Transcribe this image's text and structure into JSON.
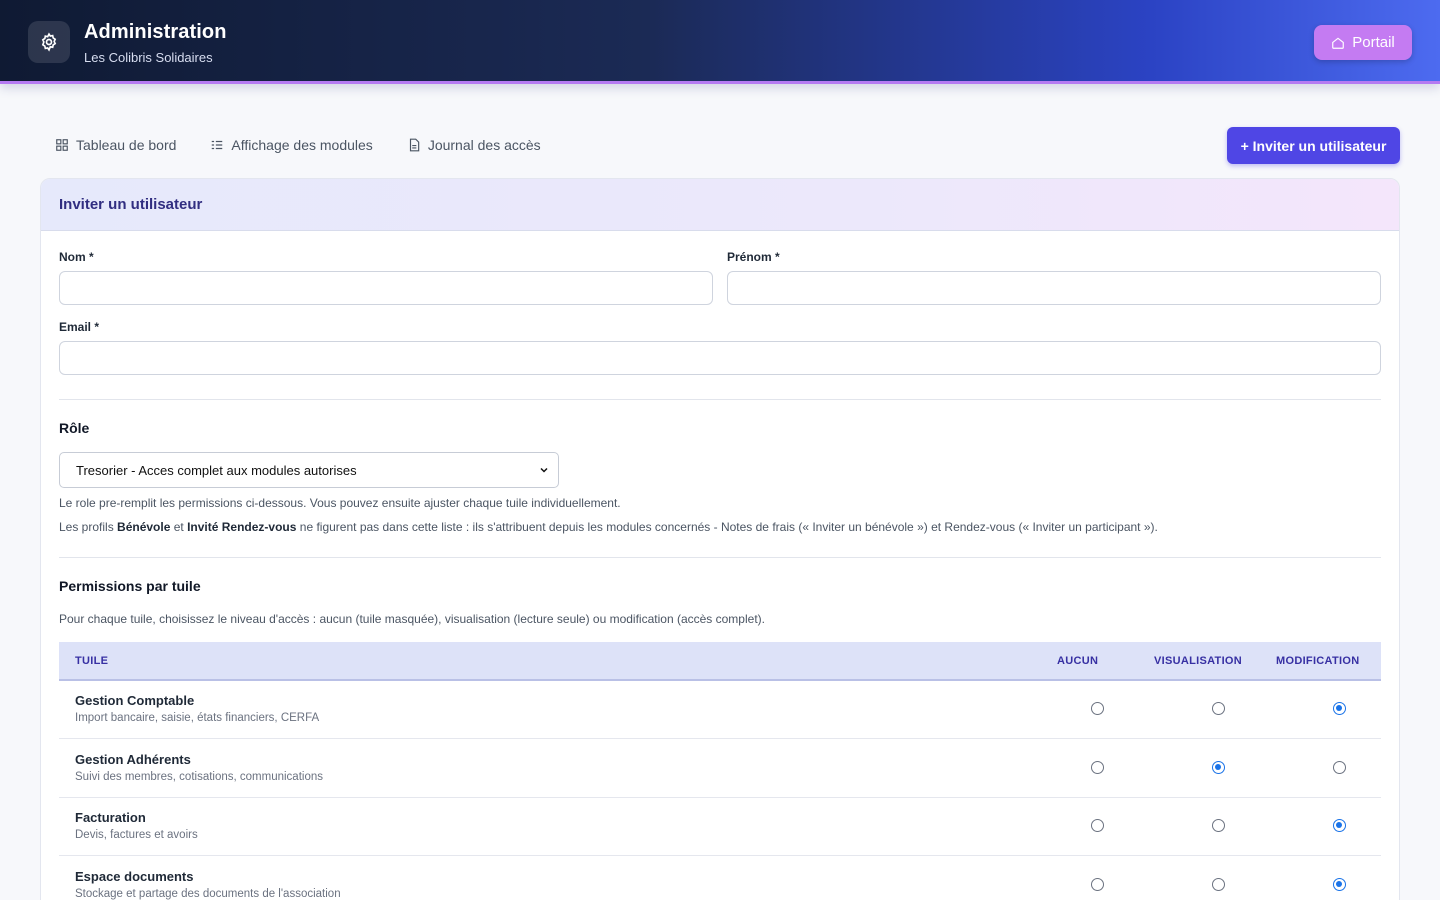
{
  "header": {
    "title": "Administration",
    "subtitle": "Les Colibris Solidaires",
    "portal_label": "Portail"
  },
  "nav": {
    "items": [
      {
        "label": "Tableau de bord",
        "icon": "dashboard-grid-icon"
      },
      {
        "label": "Affichage des modules",
        "icon": "list-icon"
      },
      {
        "label": "Journal des accès",
        "icon": "document-icon"
      }
    ],
    "invite_label": "+ Inviter un utilisateur"
  },
  "form": {
    "card_title": "Inviter un utilisateur",
    "nom_label": "Nom *",
    "prenom_label": "Prénom *",
    "email_label": "Email *",
    "role_title": "Rôle",
    "role_selected": "Tresorier - Acces complet aux modules autorises",
    "role_hint": "Le role pre-remplit les permissions ci-dessous. Vous pouvez ensuite ajuster chaque tuile individuellement.",
    "profiles_hint_prefix": "Les profils ",
    "profiles_hint_b1": "Bénévole",
    "profiles_hint_mid": " et ",
    "profiles_hint_b2": "Invité Rendez-vous",
    "profiles_hint_suffix": " ne figurent pas dans cette liste : ils s'attribuent depuis les modules concernés - Notes de frais (« Inviter un bénévole ») et Rendez-vous (« Inviter un participant »).",
    "perm_title": "Permissions par tuile",
    "perm_hint": "Pour chaque tuile, choisissez le niveau d'accès : aucun (tuile masquée), visualisation (lecture seule) ou modification (accès complet)."
  },
  "table": {
    "headers": [
      "TUILE",
      "AUCUN",
      "VISUALISATION",
      "MODIFICATION"
    ],
    "rows": [
      {
        "name": "Gestion Comptable",
        "desc": "Import bancaire, saisie, états financiers, CERFA",
        "level": "modification"
      },
      {
        "name": "Gestion Adhérents",
        "desc": "Suivi des membres, cotisations, communications",
        "level": "visualisation"
      },
      {
        "name": "Facturation",
        "desc": "Devis, factures et avoirs",
        "level": "modification"
      },
      {
        "name": "Espace documents",
        "desc": "Stockage et partage des documents de l'association",
        "level": "modification"
      }
    ]
  },
  "colors": {
    "accent": "#4f46e5",
    "portal": "#c47bf2",
    "radio_checked": "#1a73e8"
  }
}
